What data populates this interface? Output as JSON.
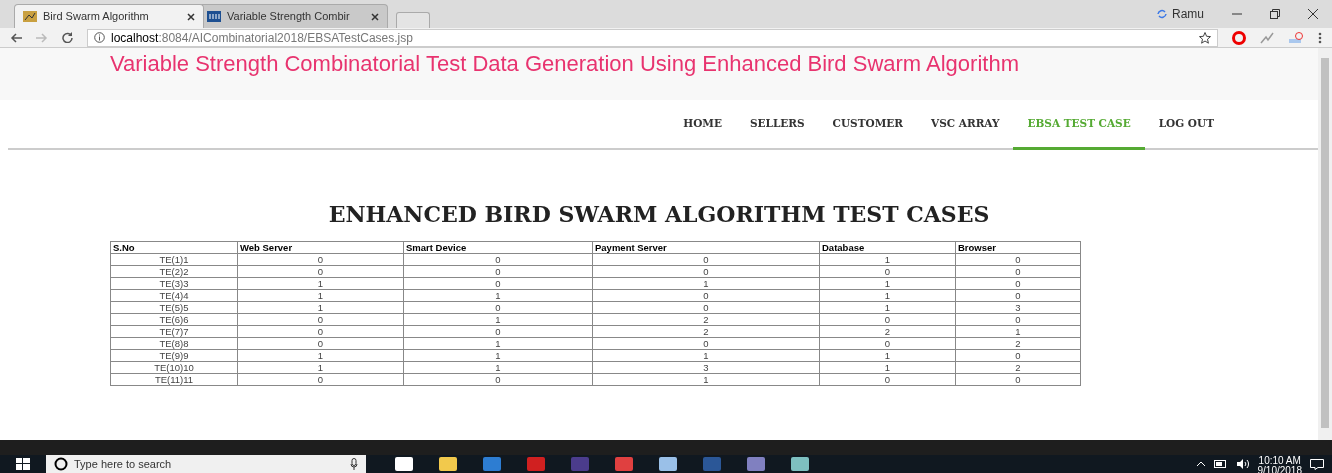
{
  "browser": {
    "tabs": [
      {
        "title": "Bird Swarm Algorithm",
        "selected": true
      },
      {
        "title": "Variable Strength Combir",
        "selected": false
      }
    ],
    "profile": "Ramu",
    "address": {
      "host": "localhost",
      "path": ":8084/AICombinatorial2018/EBSATestCases.jsp"
    }
  },
  "page": {
    "title": "Variable Strength Combinatorial Test Data Generation Using Enhanced Bird Swarm Algorithm",
    "nav": [
      {
        "label": "HOME",
        "selected": false
      },
      {
        "label": "SELLERS",
        "selected": false
      },
      {
        "label": "CUSTOMER",
        "selected": false
      },
      {
        "label": "VSC ARRAY",
        "selected": false
      },
      {
        "label": "EBSA TEST CASE",
        "selected": true
      },
      {
        "label": "LOG OUT",
        "selected": false
      }
    ],
    "heading": "ENHANCED BIRD SWARM ALGORITHM TEST CASES",
    "table": {
      "columns": [
        "S.No",
        "Web Server",
        "Smart Device",
        "Payment Server",
        "Database",
        "Browser"
      ],
      "rows": [
        [
          "TE(1)1",
          "0",
          "0",
          "0",
          "1",
          "0"
        ],
        [
          "TE(2)2",
          "0",
          "0",
          "0",
          "0",
          "0"
        ],
        [
          "TE(3)3",
          "1",
          "0",
          "1",
          "1",
          "0"
        ],
        [
          "TE(4)4",
          "1",
          "1",
          "0",
          "1",
          "0"
        ],
        [
          "TE(5)5",
          "1",
          "0",
          "0",
          "1",
          "3"
        ],
        [
          "TE(6)6",
          "0",
          "1",
          "2",
          "0",
          "0"
        ],
        [
          "TE(7)7",
          "0",
          "0",
          "2",
          "2",
          "1"
        ],
        [
          "TE(8)8",
          "0",
          "1",
          "0",
          "0",
          "2"
        ],
        [
          "TE(9)9",
          "1",
          "1",
          "1",
          "1",
          "0"
        ],
        [
          "TE(10)10",
          "1",
          "1",
          "3",
          "1",
          "2"
        ],
        [
          "TE(11)11",
          "0",
          "0",
          "1",
          "0",
          "0"
        ]
      ]
    }
  },
  "taskbar": {
    "search_placeholder": "Type here to search",
    "time": "10:10 AM",
    "date": "9/10/2018"
  }
}
